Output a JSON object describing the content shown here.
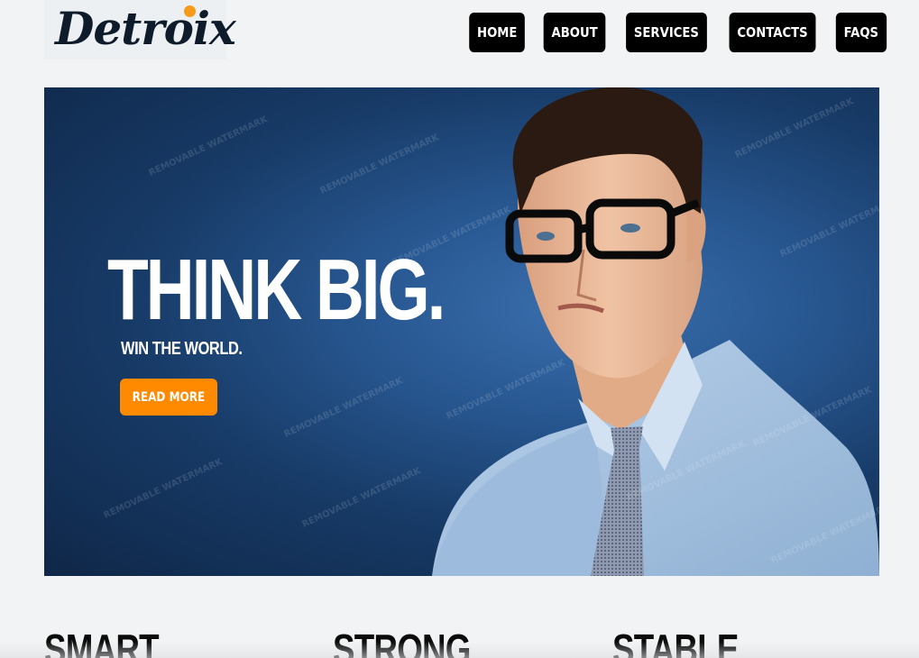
{
  "brand": {
    "name": "Detroix",
    "accent": "#f59a1b"
  },
  "nav": {
    "items": [
      {
        "label": "HOME"
      },
      {
        "label": "ABOUT"
      },
      {
        "label": "SERVICES"
      },
      {
        "label": "CONTACTS"
      },
      {
        "label": "FAQS"
      }
    ]
  },
  "hero": {
    "title": "THINK BIG.",
    "subtitle": "WIN THE WORLD.",
    "cta_label": "READ MORE",
    "cta_color": "#ff8a00",
    "watermark_text": "REMOVABLE WATERMARK"
  },
  "features": [
    {
      "title": "SMART"
    },
    {
      "title": "STRONG"
    },
    {
      "title": "STABLE"
    }
  ]
}
